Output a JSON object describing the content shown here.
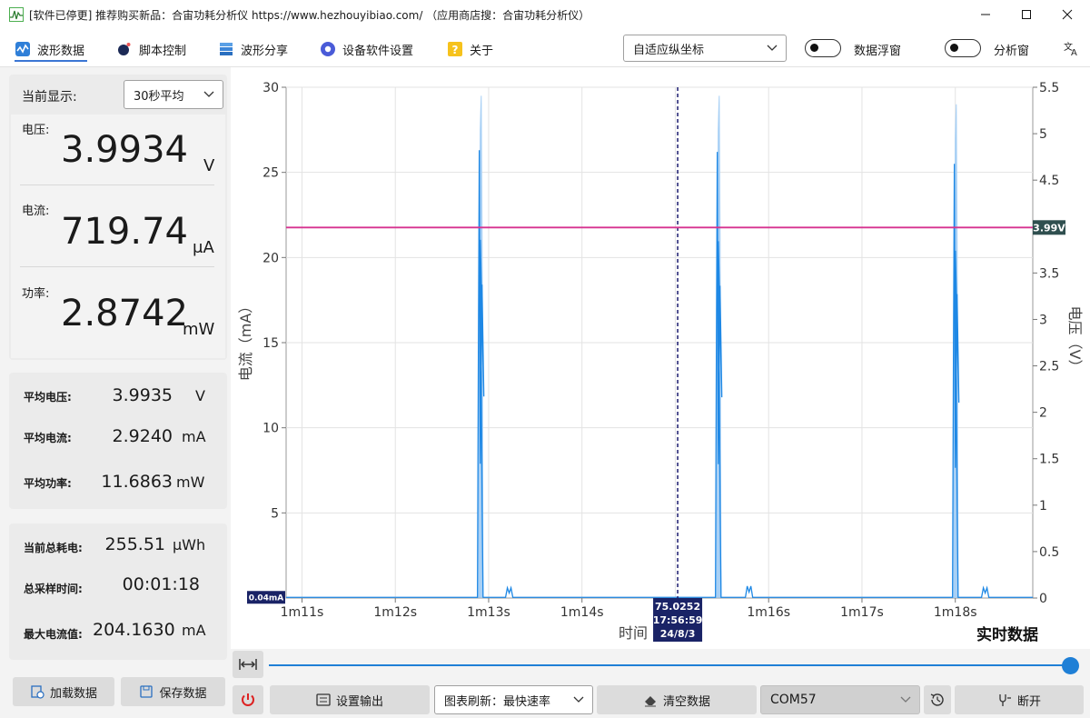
{
  "window": {
    "title": "[软件已停更] 推荐购买新品：合宙功耗分析仪 https://www.hezhouyibiao.com/ （应用商店搜：合宙功耗分析仪）"
  },
  "menu": {
    "items": [
      {
        "label": "波形数据",
        "icon": "waveform-icon"
      },
      {
        "label": "脚本控制",
        "icon": "script-icon"
      },
      {
        "label": "波形分享",
        "icon": "share-icon"
      },
      {
        "label": "设备软件设置",
        "icon": "settings-icon"
      },
      {
        "label": "关于",
        "icon": "help-icon"
      }
    ],
    "axis_mode": "自适应纵坐标",
    "float_window_label": "数据浮窗",
    "analysis_window_label": "分析窗"
  },
  "display": {
    "current_label": "当前显示:",
    "mode": "30秒平均",
    "voltage_label": "电压:",
    "voltage_value": "3.9934",
    "voltage_unit": "V",
    "current_label2": "电流:",
    "current_value": "719.74",
    "current_unit": "μA",
    "power_label": "功率:",
    "power_value": "2.8742",
    "power_unit": "mW"
  },
  "averages": {
    "avg_voltage_label": "平均电压:",
    "avg_voltage_value": "3.9935",
    "avg_voltage_unit": "V",
    "avg_current_label": "平均电流:",
    "avg_current_value": "2.9240",
    "avg_current_unit": "mA",
    "avg_power_label": "平均功率:",
    "avg_power_value": "11.6863",
    "avg_power_unit": "mW"
  },
  "totals": {
    "energy_label": "当前总耗电:",
    "energy_value": "255.51",
    "energy_unit": "μWh",
    "sample_time_label": "总采样时间:",
    "sample_time_value": "00:01:18",
    "max_current_label": "最大电流值:",
    "max_current_value": "204.1630",
    "max_current_unit": "mA"
  },
  "buttons": {
    "load_data": "加载数据",
    "save_data": "保存数据",
    "output_settings": "设置输出",
    "refresh_rate": "图表刷新：最快速率",
    "clear_data": "清空数据",
    "port": "COM57",
    "disconnect": "断开"
  },
  "chart_data": {
    "type": "line",
    "xlabel": "时间",
    "ylabel_left": "电流（mA）",
    "ylabel_right": "电压（V）",
    "ylim_left": [
      0,
      30
    ],
    "ylim_right": [
      0,
      5.5
    ],
    "xlim_s": [
      70.83,
      78.83
    ],
    "yticks_left": [
      5,
      10,
      15,
      20,
      25,
      30
    ],
    "yticks_right": [
      0,
      0.5,
      1,
      1.5,
      2,
      2.5,
      3,
      3.5,
      4,
      4.5,
      5,
      5.5
    ],
    "xticks": [
      {
        "t": 71,
        "label": "1m11s"
      },
      {
        "t": 72,
        "label": "1m12s"
      },
      {
        "t": 73,
        "label": "1m13s"
      },
      {
        "t": 74,
        "label": "1m14s"
      },
      {
        "t": 75,
        "label": "1m15s"
      },
      {
        "t": 76,
        "label": "1m16s"
      },
      {
        "t": 77,
        "label": "1m17s"
      },
      {
        "t": 78,
        "label": "1m18s"
      }
    ],
    "current_series": {
      "name": "电流",
      "baseline_mA": 0.04,
      "pulses": [
        {
          "start_s": 72.89,
          "end_s": 72.94,
          "peak_mA": 26.3,
          "max_envelope_mA": 29.5
        },
        {
          "start_s": 75.44,
          "end_s": 75.49,
          "peak_mA": 26.2,
          "max_envelope_mA": 29.5
        },
        {
          "start_s": 77.98,
          "end_s": 78.03,
          "peak_mA": 25.5,
          "max_envelope_mA": 29.0
        }
      ],
      "small_bumps": [
        {
          "t_s": 73.22,
          "mA": 0.6
        },
        {
          "t_s": 75.79,
          "mA": 0.7
        },
        {
          "t_s": 78.32,
          "mA": 0.6
        }
      ]
    },
    "voltage_series": {
      "name": "电压",
      "value_V": 3.99
    },
    "cursor": {
      "t_s": 75.0252,
      "label_lines": [
        "75.0252",
        "17:56:59",
        "24/8/3"
      ]
    },
    "left_value_tag": "0.04mA",
    "right_value_tag": "3.99V",
    "mode_label": "实时数据"
  },
  "colors": {
    "current": "#1e88e5",
    "current_envelope": "#a8d0f5",
    "voltage": "#d6338f",
    "cursor": "#1a1a6e",
    "accent": "#1e7fd6"
  }
}
